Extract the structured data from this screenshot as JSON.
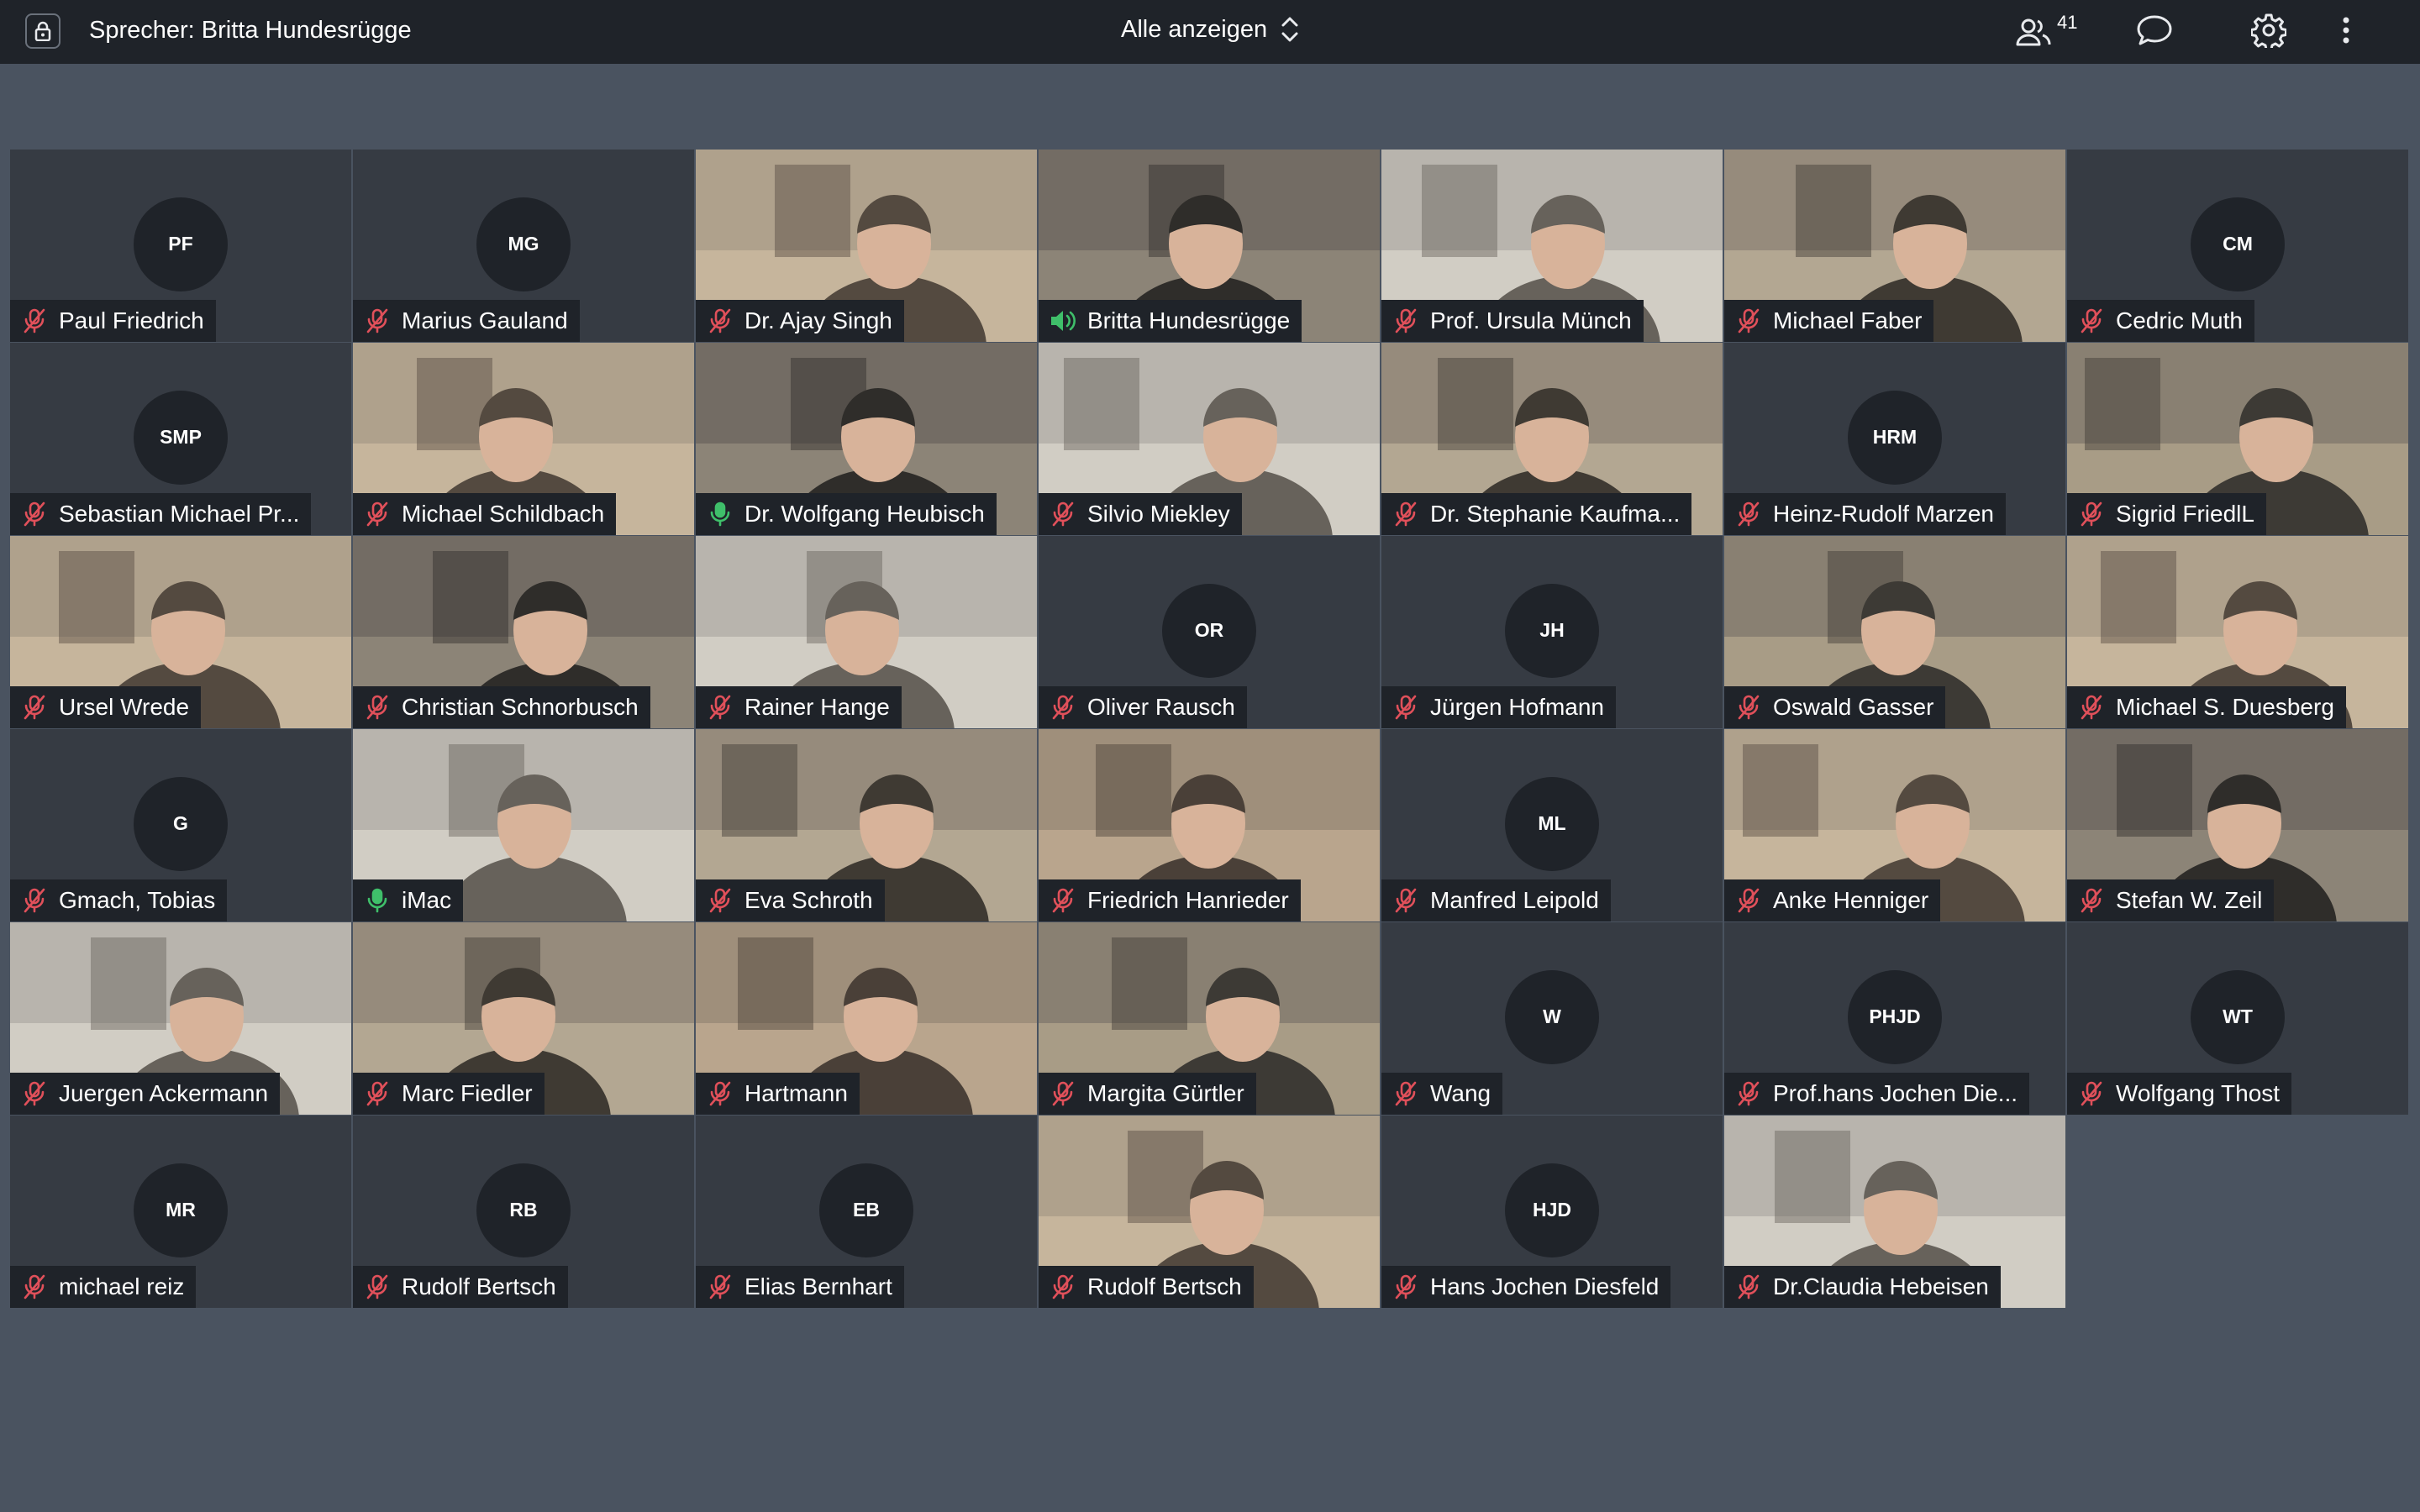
{
  "topbar": {
    "speaker_text": "Sprecher: Britta Hundesrügge",
    "view_label": "Alle anzeigen",
    "participant_count": "41"
  },
  "colors": {
    "topbar": "#1f2329",
    "stage": "#4a5360",
    "tile": "#363b43",
    "muted_icon": "#e0505a",
    "unmuted_icon": "#3fbf6a"
  },
  "tiles": [
    {
      "name": "Paul Friedrich",
      "initials": "PF",
      "mic": "muted",
      "video": false
    },
    {
      "name": "Marius Gauland",
      "initials": "MG",
      "mic": "muted",
      "video": false
    },
    {
      "name": "Dr. Ajay Singh",
      "initials": "",
      "mic": "muted",
      "video": true
    },
    {
      "name": "Britta Hundesrügge",
      "initials": "",
      "mic": "speaking",
      "video": true
    },
    {
      "name": "Prof. Ursula Münch",
      "initials": "",
      "mic": "muted",
      "video": true
    },
    {
      "name": "Michael Faber",
      "initials": "",
      "mic": "muted",
      "video": true
    },
    {
      "name": "Cedric Muth",
      "initials": "CM",
      "mic": "muted",
      "video": false
    },
    {
      "name": "Sebastian Michael Pr...",
      "initials": "SMP",
      "mic": "muted",
      "video": false
    },
    {
      "name": "Michael Schildbach",
      "initials": "",
      "mic": "muted",
      "video": true
    },
    {
      "name": "Dr. Wolfgang Heubisch",
      "initials": "",
      "mic": "unmuted",
      "video": true
    },
    {
      "name": "Silvio Miekley",
      "initials": "",
      "mic": "muted",
      "video": true
    },
    {
      "name": "Dr. Stephanie Kaufma...",
      "initials": "",
      "mic": "muted",
      "video": true
    },
    {
      "name": "Heinz-Rudolf Marzen",
      "initials": "HRM",
      "mic": "muted",
      "video": false
    },
    {
      "name": "Sigrid FriedlL",
      "initials": "",
      "mic": "muted",
      "video": true
    },
    {
      "name": "Ursel Wrede",
      "initials": "",
      "mic": "muted",
      "video": true
    },
    {
      "name": "Christian Schnorbusch",
      "initials": "",
      "mic": "muted",
      "video": true
    },
    {
      "name": "Rainer Hange",
      "initials": "",
      "mic": "muted",
      "video": true
    },
    {
      "name": "Oliver Rausch",
      "initials": "OR",
      "mic": "muted",
      "video": false
    },
    {
      "name": "Jürgen Hofmann",
      "initials": "JH",
      "mic": "muted",
      "video": false
    },
    {
      "name": "Oswald Gasser",
      "initials": "",
      "mic": "muted",
      "video": true
    },
    {
      "name": "Michael S. Duesberg",
      "initials": "",
      "mic": "muted",
      "video": true
    },
    {
      "name": "Gmach, Tobias",
      "initials": "G",
      "mic": "muted",
      "video": false
    },
    {
      "name": "iMac",
      "initials": "",
      "mic": "unmuted",
      "video": true
    },
    {
      "name": "Eva Schroth",
      "initials": "",
      "mic": "muted",
      "video": true
    },
    {
      "name": "Friedrich Hanrieder",
      "initials": "",
      "mic": "muted",
      "video": true
    },
    {
      "name": "Manfred Leipold",
      "initials": "ML",
      "mic": "muted",
      "video": false
    },
    {
      "name": "Anke Henniger",
      "initials": "",
      "mic": "muted",
      "video": true
    },
    {
      "name": "Stefan W. Zeil",
      "initials": "",
      "mic": "muted",
      "video": true
    },
    {
      "name": "Juergen Ackermann",
      "initials": "",
      "mic": "muted",
      "video": true
    },
    {
      "name": "Marc Fiedler",
      "initials": "",
      "mic": "muted",
      "video": true
    },
    {
      "name": "Hartmann",
      "initials": "",
      "mic": "muted",
      "video": true
    },
    {
      "name": "Margita Gürtler",
      "initials": "",
      "mic": "muted",
      "video": true
    },
    {
      "name": "Wang",
      "initials": "W",
      "mic": "muted",
      "video": false
    },
    {
      "name": "Prof.hans Jochen Die...",
      "initials": "PHJD",
      "mic": "muted",
      "video": false
    },
    {
      "name": "Wolfgang Thost",
      "initials": "WT",
      "mic": "muted",
      "video": false
    },
    {
      "name": "michael reiz",
      "initials": "MR",
      "mic": "muted",
      "video": false
    },
    {
      "name": "Rudolf  Bertsch",
      "initials": "RB",
      "mic": "muted",
      "video": false
    },
    {
      "name": "Elias Bernhart",
      "initials": "EB",
      "mic": "muted",
      "video": false
    },
    {
      "name": "Rudolf Bertsch",
      "initials": "",
      "mic": "muted",
      "video": true
    },
    {
      "name": "Hans Jochen Diesfeld",
      "initials": "HJD",
      "mic": "muted",
      "video": false
    },
    {
      "name": "Dr.Claudia Hebeisen",
      "initials": "",
      "mic": "muted",
      "video": true
    }
  ]
}
